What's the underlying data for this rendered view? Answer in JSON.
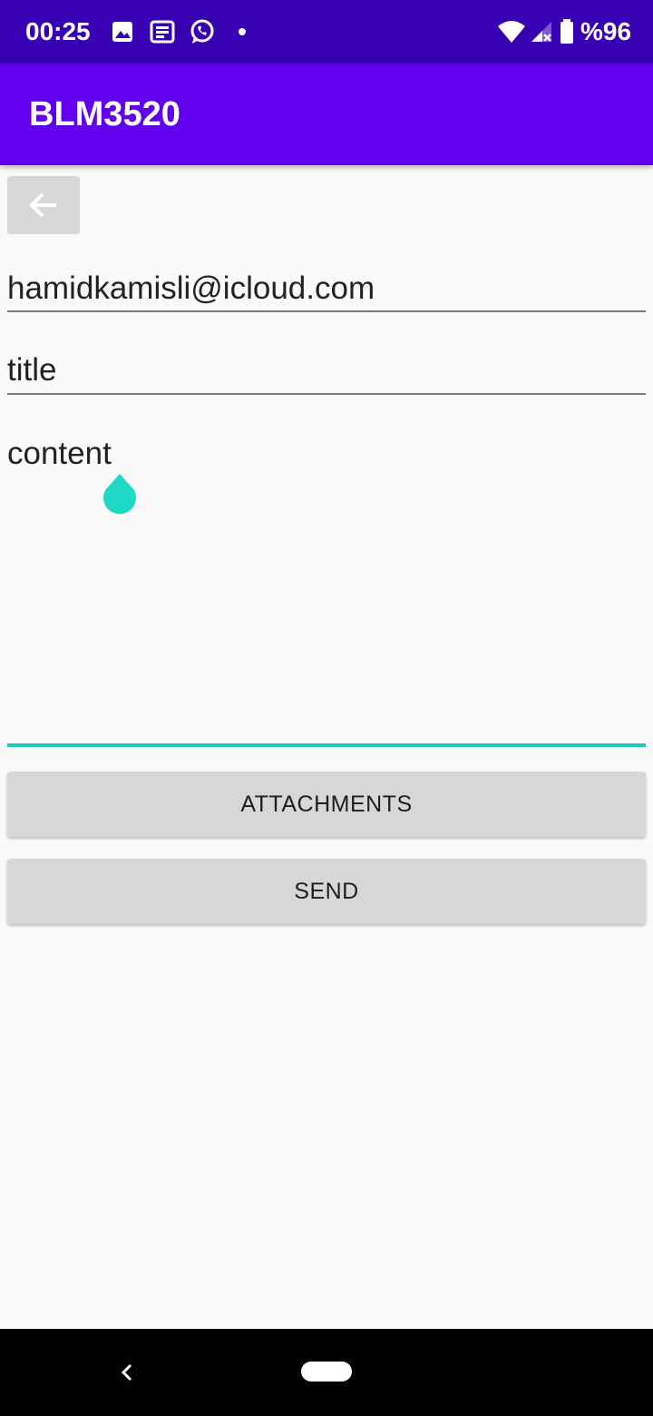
{
  "status_bar": {
    "time": "00:25",
    "left_icons": [
      "gallery-icon",
      "news-icon",
      "whatsapp-icon",
      "dot-icon"
    ],
    "right_icons": [
      "wifi-icon",
      "cell-signal-icon",
      "battery-icon"
    ],
    "battery_text": "%96",
    "background": "#3700b3"
  },
  "app_bar": {
    "title": "BLM3520",
    "background": "#6200ee"
  },
  "form": {
    "back_icon": "arrow-left-icon",
    "to_value": "hamidkamisli@icloud.com",
    "title_value": "title",
    "content_value": "content",
    "accent": "#1ec9bd"
  },
  "buttons": {
    "attachments_label": "ATTACHMENTS",
    "send_label": "SEND"
  },
  "nav_bar": {
    "back_icon": "chevron-left-icon",
    "home_icon": "home-pill-icon"
  }
}
